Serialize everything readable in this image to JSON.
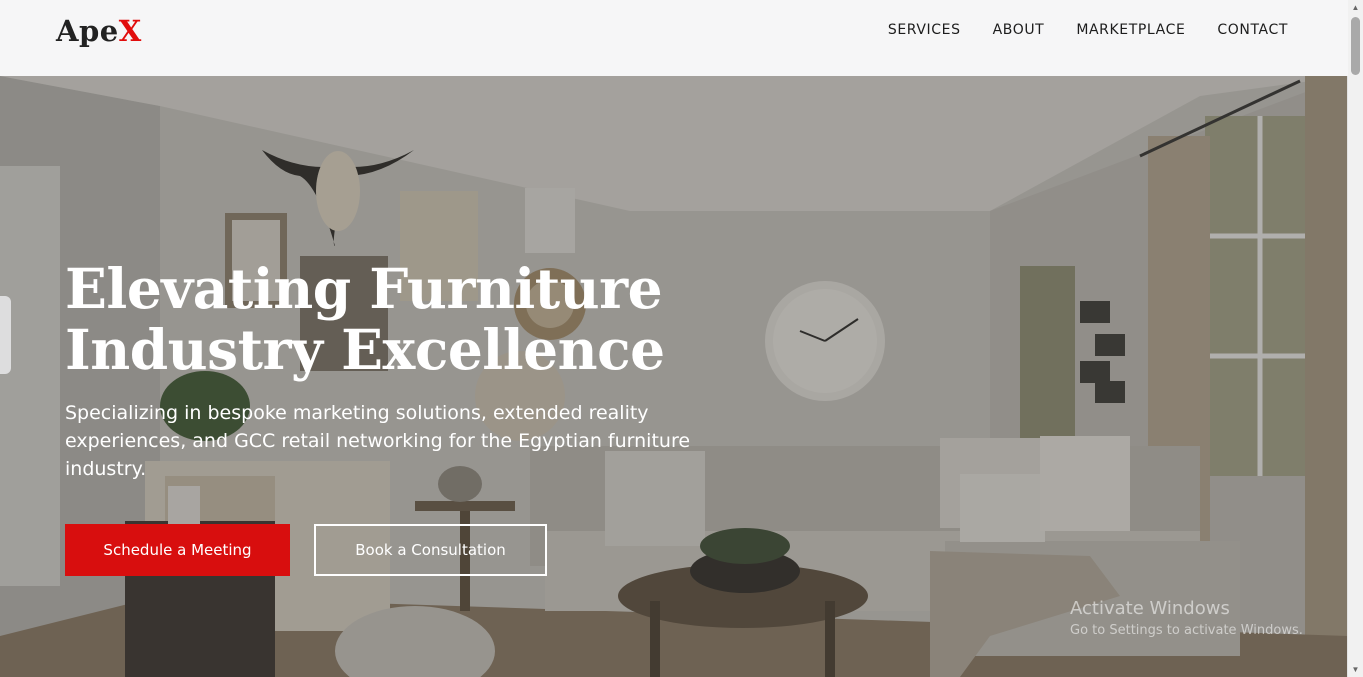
{
  "brand": {
    "logo_main": "Ape",
    "logo_accent": "X"
  },
  "nav": [
    {
      "label": "SERVICES"
    },
    {
      "label": "ABOUT"
    },
    {
      "label": "MARKETPLACE"
    },
    {
      "label": "CONTACT"
    }
  ],
  "hero": {
    "title_line1": "Elevating Furniture",
    "title_line2": "Industry Excellence",
    "subtitle": "Specializing in bespoke marketing solutions, extended reality experiences, and GCC retail networking for the Egyptian furniture industry.",
    "primary_button": "Schedule a Meeting",
    "secondary_button": "Book a Consultation"
  },
  "watermark": {
    "line1": "Activate Windows",
    "line2": "Go to Settings to activate Windows."
  },
  "colors": {
    "accent": "#d80e0e",
    "header_bg": "#f6f6f7"
  }
}
